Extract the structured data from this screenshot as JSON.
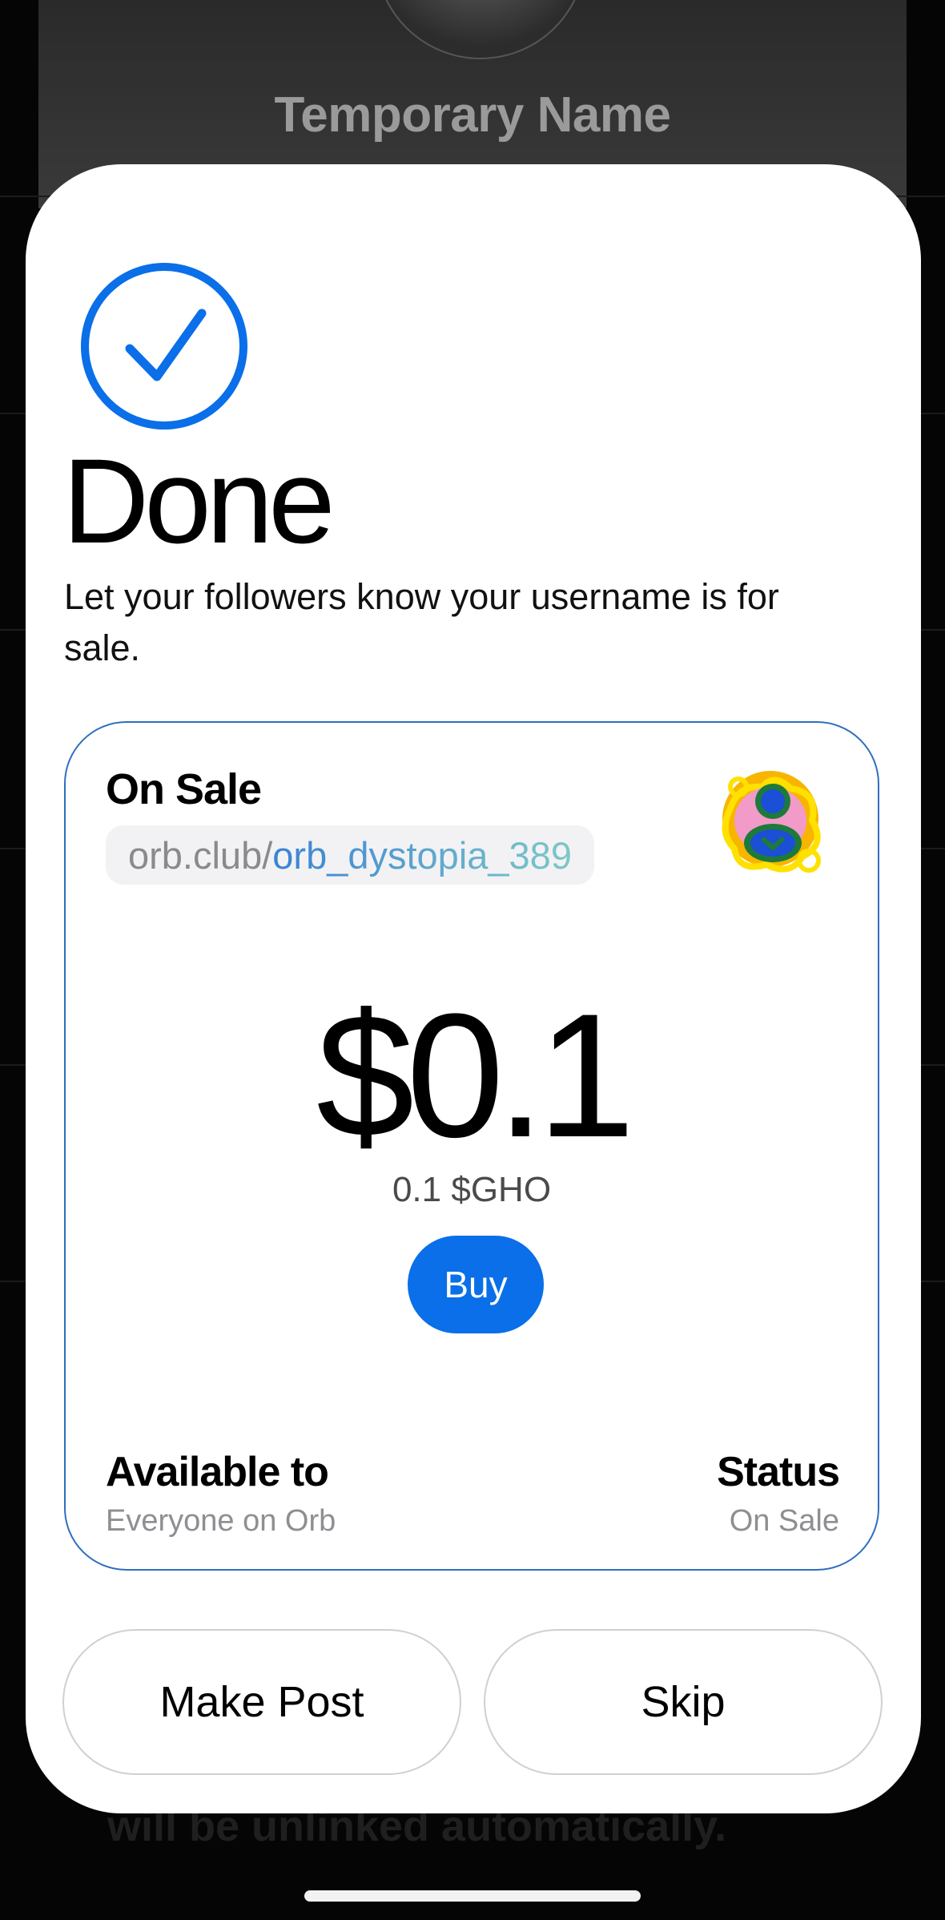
{
  "background": {
    "profile_name": "Temporary Name",
    "footer_text": "will be unlinked automatically."
  },
  "sheet": {
    "title": "Done",
    "subtitle": "Let your followers know your username is for sale.",
    "check_icon": "checkmark-circle-icon",
    "accent_color": "#0a6fe8"
  },
  "card": {
    "label": "On Sale",
    "url_domain": "orb.club/",
    "url_handle": "orb_dystopia_389",
    "avatar_icon": "orb-avatar-icon",
    "price": "$0.1",
    "price_token": "0.1 $GHO",
    "buy_label": "Buy",
    "available_label": "Available to",
    "available_value": "Everyone on Orb",
    "status_label": "Status",
    "status_value": "On Sale",
    "border_color": "#2f6fbf"
  },
  "actions": {
    "make_post_label": "Make Post",
    "skip_label": "Skip"
  }
}
